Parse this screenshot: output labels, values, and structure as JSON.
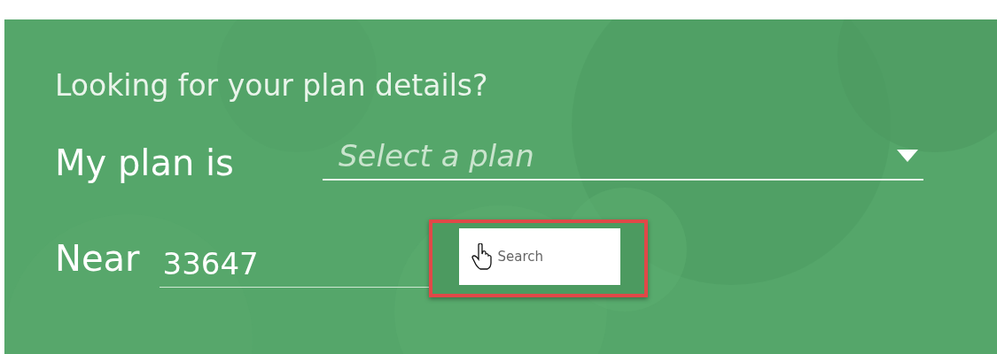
{
  "heading": "Looking for your plan details?",
  "plan": {
    "label": "My plan is",
    "placeholder": "Select a plan"
  },
  "location": {
    "label": "Near",
    "value": "33647"
  },
  "search_button": {
    "label": "Search",
    "highlighted": true
  }
}
